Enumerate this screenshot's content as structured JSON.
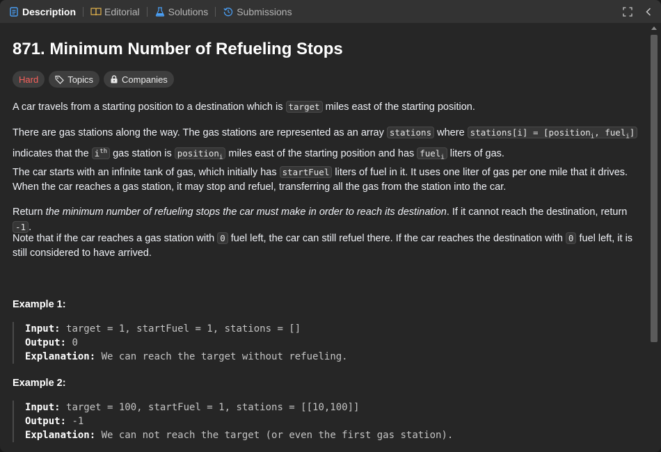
{
  "tabs": [
    {
      "label": "Description",
      "icon": "description-icon",
      "active": true
    },
    {
      "label": "Editorial",
      "icon": "book-icon",
      "active": false
    },
    {
      "label": "Solutions",
      "icon": "flask-icon",
      "active": false
    },
    {
      "label": "Submissions",
      "icon": "history-icon",
      "active": false
    }
  ],
  "problem": {
    "title": "871. Minimum Number of Refueling Stops",
    "difficulty": "Hard",
    "topics_label": "Topics",
    "companies_label": "Companies",
    "p1": {
      "a": "A car travels from a starting position to a destination which is ",
      "code": "target",
      "b": " miles east of the starting position."
    },
    "p2": {
      "a": "There are gas stations along the way. The gas stations are represented as an array ",
      "code1": "stations",
      "b": " where ",
      "code2a": "stations[i] = [position",
      "code2sub1": "i",
      "code2b": ", fuel",
      "code2sub2": "i",
      "code2c": "]",
      "c": "indicates that the ",
      "ith_base": "i",
      "ith_sup": "th",
      "d": " gas station is ",
      "code3": "position",
      "code3sub": "i",
      "e": " miles east of the starting position and has ",
      "code4": "fuel",
      "code4sub": "i",
      "f": " liters of gas."
    },
    "p3": {
      "a": "The car starts with an infinite tank of gas, which initially has ",
      "code": "startFuel",
      "b": " liters of fuel in it. It uses one liter of gas per one mile that it drives. When the car reaches a gas station, it may stop and refuel, transferring all the gas from the station into the car."
    },
    "p4": {
      "a": "Return ",
      "em": "the minimum number of refueling stops the car must make in order to reach its destination",
      "b": ". If it cannot reach the destination, return ",
      "code": "-1",
      "c": "."
    },
    "p5": {
      "a": "Note that if the car reaches a gas station with ",
      "code1": "0",
      "b": " fuel left, the car can still refuel there. If the car reaches the destination with ",
      "code2": "0",
      "c": " fuel left, it is still considered to have arrived."
    },
    "examples": [
      {
        "title": "Example 1:",
        "input_label": "Input:",
        "input": "target = 1, startFuel = 1, stations = []",
        "output_label": "Output:",
        "output": "0",
        "explanation_label": "Explanation:",
        "explanation": "We can reach the target without refueling."
      },
      {
        "title": "Example 2:",
        "input_label": "Input:",
        "input": "target = 100, startFuel = 1, stations = [[10,100]]",
        "output_label": "Output:",
        "output": "-1",
        "explanation_label": "Explanation:",
        "explanation": "We can not reach the target (or even the first gas station)."
      }
    ]
  },
  "colors": {
    "hard": "#f8615c",
    "active_tab_icon": "#4a9ff5",
    "submissions_icon": "#4a9ff5",
    "solutions_icon": "#4a9ff5",
    "editorial_icon": "#e1b24c"
  }
}
